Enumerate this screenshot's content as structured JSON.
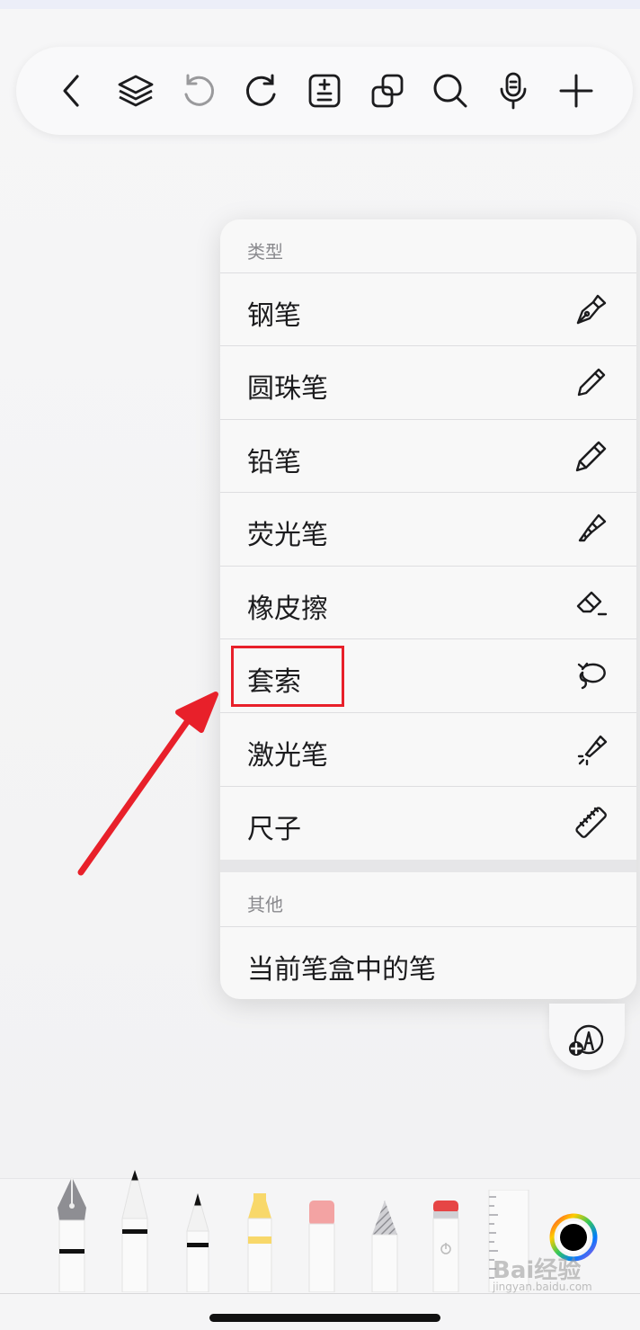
{
  "toolbar": {
    "buttons": [
      {
        "name": "back-icon"
      },
      {
        "name": "layers-icon"
      },
      {
        "name": "undo-icon"
      },
      {
        "name": "redo-icon"
      },
      {
        "name": "page-format-icon"
      },
      {
        "name": "copy-icon"
      },
      {
        "name": "search-icon"
      },
      {
        "name": "microphone-icon"
      },
      {
        "name": "add-icon"
      }
    ]
  },
  "menu": {
    "type_header": "类型",
    "items": [
      {
        "label": "钢笔",
        "icon": "fountain-pen-icon"
      },
      {
        "label": "圆珠笔",
        "icon": "ballpoint-pen-icon"
      },
      {
        "label": "铅笔",
        "icon": "pencil-icon"
      },
      {
        "label": "荧光笔",
        "icon": "highlighter-icon"
      },
      {
        "label": "橡皮擦",
        "icon": "eraser-icon"
      },
      {
        "label": "套索",
        "icon": "lasso-icon"
      },
      {
        "label": "激光笔",
        "icon": "laser-pointer-icon"
      },
      {
        "label": "尺子",
        "icon": "ruler-icon"
      }
    ],
    "other_header": "其他",
    "other_item": "当前笔盒中的笔"
  },
  "colors": {
    "highlight": "#e8202a",
    "current_color": "#000000"
  },
  "watermark": {
    "brand": "Bai经验",
    "url": "jingyan.baidu.com"
  }
}
